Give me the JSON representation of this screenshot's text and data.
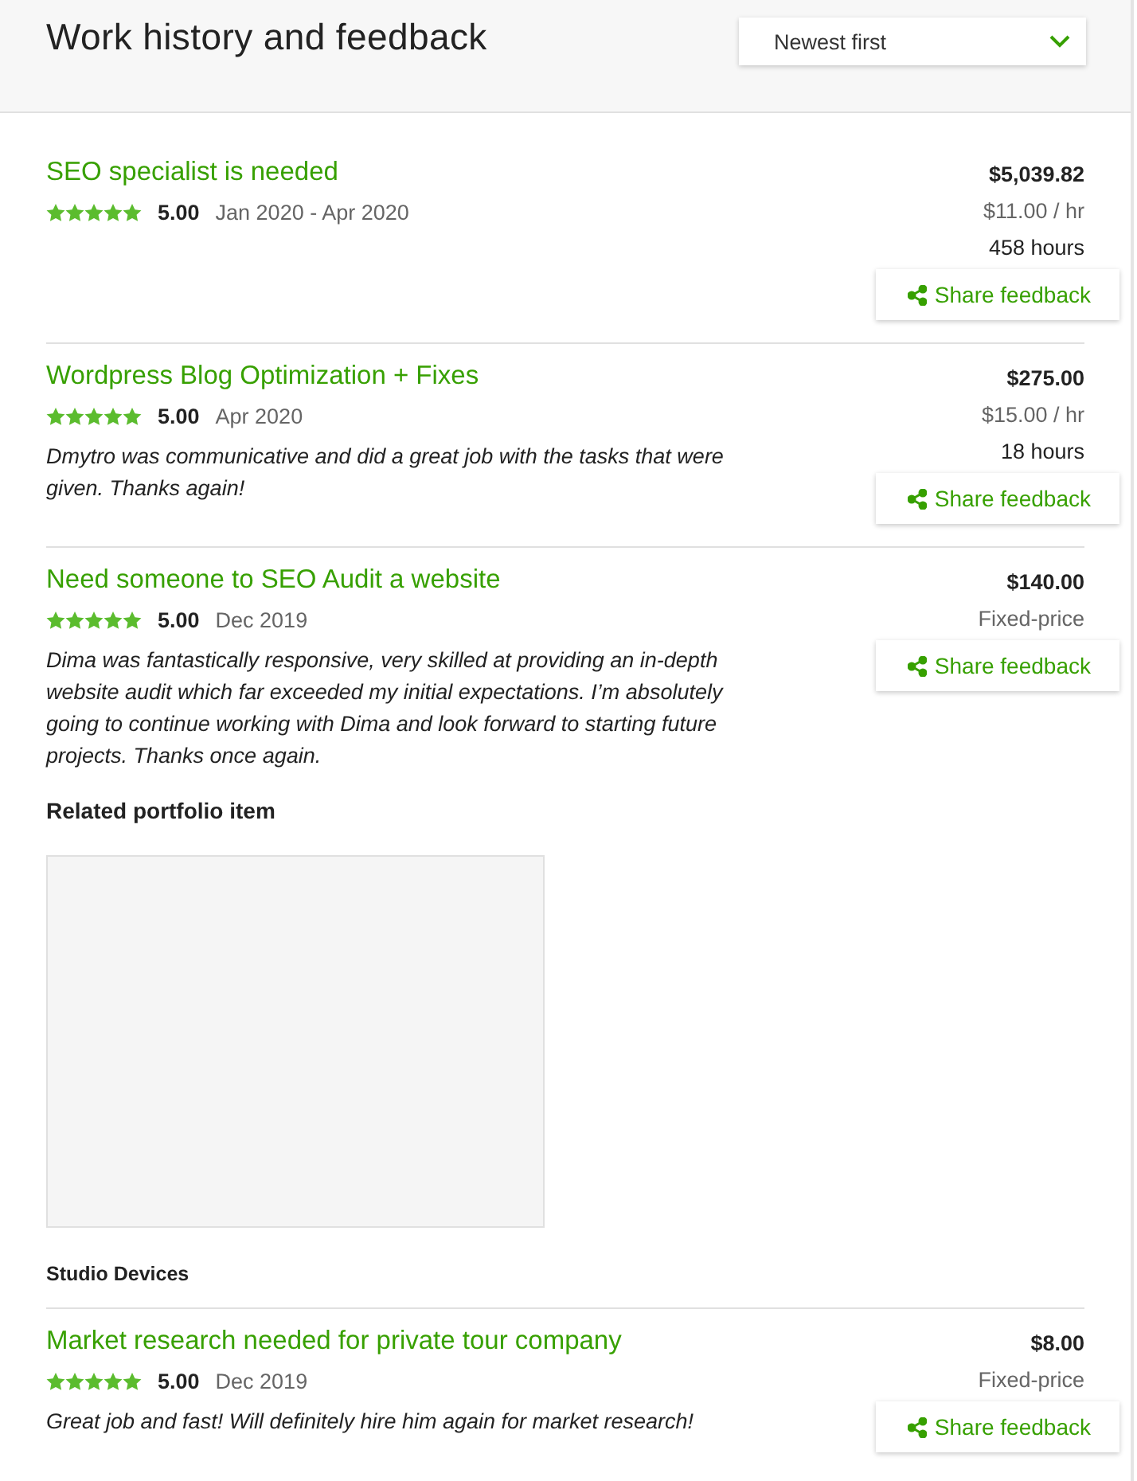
{
  "header": {
    "title": "Work history and feedback",
    "sort": {
      "value": "Newest first"
    }
  },
  "jobs": [
    {
      "title": "SEO specialist is needed",
      "stars": 5,
      "rating": "5.00",
      "dates": "Jan 2020 - Apr 2020",
      "amount": "$5,039.82",
      "rate": "$11.00 / hr",
      "hours": "458 hours",
      "share": "Share feedback"
    },
    {
      "title": "Wordpress Blog Optimization + Fixes",
      "stars": 5,
      "rating": "5.00",
      "dates": "Apr 2020",
      "comment": "Dmytro was communicative and did a great job with the tasks that were given. Thanks again!",
      "amount": "$275.00",
      "rate": "$15.00 / hr",
      "hours": "18 hours",
      "share": "Share feedback"
    },
    {
      "title": "Need someone to SEO Audit a website",
      "stars": 5,
      "rating": "5.00",
      "dates": "Dec 2019",
      "comment": "Dima was fantastically responsive, very skilled at providing an in-depth website audit which far exceeded my initial expectations. I’m absolutely going to continue working with Dima and look forward to starting future projects. Thanks once again.",
      "amount": "$140.00",
      "rate": "Fixed-price",
      "share": "Share feedback",
      "portfolio": {
        "heading": "Related portfolio item",
        "title": "Studio Devices"
      }
    },
    {
      "title": "Market research needed for private tour company",
      "stars": 5,
      "rating": "5.00",
      "dates": "Dec 2019",
      "comment": "Great job and fast! Will definitely hire him again for market research!",
      "amount": "$8.00",
      "rate": "Fixed-price",
      "share": "Share feedback"
    }
  ]
}
